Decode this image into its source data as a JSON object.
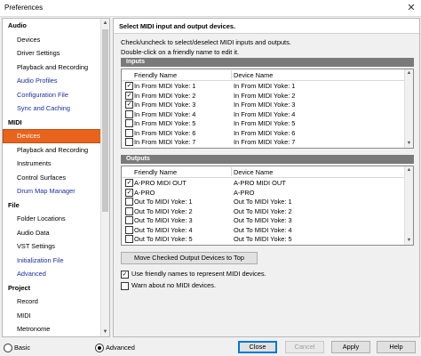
{
  "window": {
    "title": "Preferences",
    "close_glyph": "✕"
  },
  "sidebar": {
    "items": [
      {
        "label": "Audio",
        "type": "cat"
      },
      {
        "label": "Devices",
        "type": "item"
      },
      {
        "label": "Driver Settings",
        "type": "item"
      },
      {
        "label": "Playback and Recording",
        "type": "item"
      },
      {
        "label": "Audio Profiles",
        "type": "item",
        "blue": true
      },
      {
        "label": "Configuration File",
        "type": "item",
        "blue": true
      },
      {
        "label": "Sync and Caching",
        "type": "item",
        "blue": true
      },
      {
        "label": "MIDI",
        "type": "cat"
      },
      {
        "label": "Devices",
        "type": "item",
        "selected": true
      },
      {
        "label": "Playback and Recording",
        "type": "item"
      },
      {
        "label": "Instruments",
        "type": "item"
      },
      {
        "label": "Control Surfaces",
        "type": "item"
      },
      {
        "label": "Drum Map Manager",
        "type": "item",
        "blue": true
      },
      {
        "label": "File",
        "type": "cat"
      },
      {
        "label": "Folder Locations",
        "type": "item"
      },
      {
        "label": "Audio Data",
        "type": "item"
      },
      {
        "label": "VST Settings",
        "type": "item"
      },
      {
        "label": "Initialization File",
        "type": "item",
        "blue": true
      },
      {
        "label": "Advanced",
        "type": "item",
        "blue": true
      },
      {
        "label": "Project",
        "type": "cat"
      },
      {
        "label": "Record",
        "type": "item"
      },
      {
        "label": "MIDI",
        "type": "item"
      },
      {
        "label": "Metronome",
        "type": "item"
      }
    ],
    "accent_color": "#e8631c"
  },
  "content": {
    "heading": "Select MIDI input and output devices.",
    "desc1": "Check/uncheck to select/deselect MIDI inputs and outputs.",
    "desc2": "Double-click on a friendly name to edit it.",
    "inputs": {
      "group_label": "Inputs",
      "col_friendly": "Friendly Name",
      "col_device": "Device Name",
      "rows": [
        {
          "friendly": "In From MIDI Yoke:  1",
          "device": "In From MIDI Yoke:  1",
          "checked": true
        },
        {
          "friendly": "In From MIDI Yoke:  2",
          "device": "In From MIDI Yoke:  2",
          "checked": true
        },
        {
          "friendly": "In From MIDI Yoke:  3",
          "device": "In From MIDI Yoke:  3",
          "checked": true
        },
        {
          "friendly": "In From MIDI Yoke:  4",
          "device": "In From MIDI Yoke:  4",
          "checked": false
        },
        {
          "friendly": "In From MIDI Yoke:  5",
          "device": "In From MIDI Yoke:  5",
          "checked": false
        },
        {
          "friendly": "In From MIDI Yoke:  6",
          "device": "In From MIDI Yoke:  6",
          "checked": false
        },
        {
          "friendly": "In From MIDI Yoke:  7",
          "device": "In From MIDI Yoke:  7",
          "checked": false
        }
      ]
    },
    "outputs": {
      "group_label": "Outputs",
      "col_friendly": "Friendly Name",
      "col_device": "Device Name",
      "rows": [
        {
          "friendly": "A-PRO MIDI OUT",
          "device": "A-PRO MIDI OUT",
          "checked": true
        },
        {
          "friendly": "A-PRO",
          "device": "A-PRO",
          "checked": true
        },
        {
          "friendly": "Out To MIDI Yoke:  1",
          "device": "Out To MIDI Yoke:  1",
          "checked": false
        },
        {
          "friendly": "Out To MIDI Yoke:  2",
          "device": "Out To MIDI Yoke:  2",
          "checked": false
        },
        {
          "friendly": "Out To MIDI Yoke:  3",
          "device": "Out To MIDI Yoke:  3",
          "checked": false
        },
        {
          "friendly": "Out To MIDI Yoke:  4",
          "device": "Out To MIDI Yoke:  4",
          "checked": false
        },
        {
          "friendly": "Out To MIDI Yoke:  5",
          "device": "Out To MIDI Yoke:  5",
          "checked": false
        }
      ]
    },
    "move_button": "Move Checked Output Devices to Top",
    "use_friendly": {
      "label": "Use friendly names to represent MIDI devices.",
      "checked": true
    },
    "warn_no_midi": {
      "label": "Warn about no MIDI devices.",
      "checked": false
    }
  },
  "footer": {
    "basic_label": "Basic",
    "advanced_label": "Advanced",
    "mode": "Advanced",
    "close": "Close",
    "cancel": "Cancel",
    "apply": "Apply",
    "help": "Help"
  },
  "icons": {
    "check": "✓",
    "scroll_up": "▲",
    "scroll_down": "▼"
  }
}
